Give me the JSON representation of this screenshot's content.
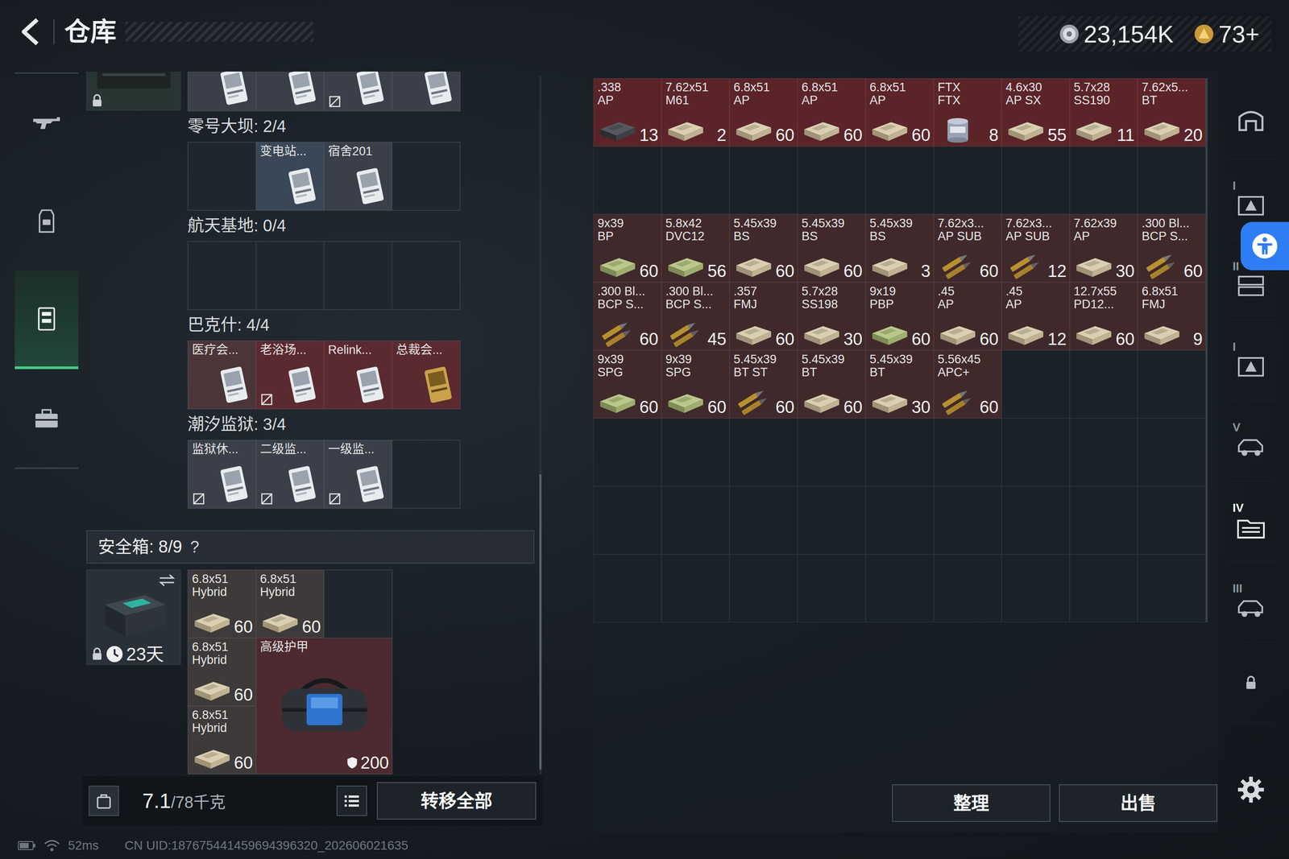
{
  "header": {
    "title": "仓库"
  },
  "currency": [
    {
      "amount": "23,154K",
      "kind": "silver"
    },
    {
      "amount": "73+",
      "kind": "gold"
    }
  ],
  "sidebar": {
    "items": [
      {
        "kind": "weapon",
        "selected": false
      },
      {
        "kind": "gear",
        "selected": false
      },
      {
        "kind": "storage",
        "selected": true
      },
      {
        "kind": "case",
        "selected": false
      }
    ]
  },
  "top_row": {
    "locked": true,
    "slots": [
      {
        "bound": false
      },
      {
        "bound": false
      },
      {
        "bound": true
      },
      {
        "bound": false
      }
    ]
  },
  "key_groups": [
    {
      "title": "零号大坝: 2/4",
      "slots": [
        null,
        {
          "label": "变电站...",
          "kind": "card",
          "color": "#3a4756",
          "bound": false
        },
        {
          "label": "宿舍201",
          "kind": "card",
          "color": "#3a3f49",
          "bound": false
        },
        null
      ]
    },
    {
      "title": "航天基地: 0/4",
      "slots": [
        null,
        null,
        null,
        null
      ]
    },
    {
      "title": "巴克什: 4/4",
      "slots": [
        {
          "label": "医疗会...",
          "kind": "card",
          "color": "#4a3539",
          "bound": false
        },
        {
          "label": "老浴场...",
          "kind": "card",
          "color": "#5a2a30",
          "bound": true
        },
        {
          "label": "Relink...",
          "kind": "card",
          "color": "#5a2a30",
          "bound": false
        },
        {
          "label": "总裁会...",
          "kind": "gold",
          "color": "#5a2a30",
          "bound": false
        }
      ]
    },
    {
      "title": "潮汐监狱: 3/4",
      "slots": [
        {
          "label": "监狱休...",
          "kind": "card",
          "color": "#3a3f49",
          "bound": true
        },
        {
          "label": "二级监...",
          "kind": "card",
          "color": "#3a3f49",
          "bound": true
        },
        {
          "label": "一级监...",
          "kind": "card",
          "color": "#3a3f49",
          "bound": true
        },
        null
      ]
    }
  ],
  "safe_box": {
    "title": "安全箱: 8/9",
    "help": "?",
    "timer": "23天",
    "locked": true,
    "slots": [
      {
        "name": "6.8x51",
        "type": "Hybrid",
        "count": "60",
        "kind": "box",
        "color": "#3e3a3a"
      },
      {
        "name": "6.8x51",
        "type": "Hybrid",
        "count": "60",
        "kind": "box",
        "color": "#3e3a3a"
      },
      null,
      {
        "name": "6.8x51",
        "type": "Hybrid",
        "count": "60",
        "kind": "box",
        "color": "#3e3a3a"
      },
      {
        "name": "高级护甲",
        "count": "200",
        "kind": "armor",
        "color": "#4c2a2f"
      },
      {
        "name": "6.8x51",
        "type": "Hybrid",
        "count": "60",
        "kind": "box",
        "color": "#3e3a3a"
      }
    ]
  },
  "load": {
    "weight": "7.1",
    "capacity": "/78千克"
  },
  "transfer_button": "转移全部",
  "stash": {
    "rows": [
      [
        {
          "name": ".338",
          "type": "AP",
          "count": "13",
          "kind": "darkbox",
          "color": "#5b2429"
        },
        {
          "name": "7.62x51",
          "type": "M61",
          "count": "2",
          "kind": "box",
          "color": "#5b2429"
        },
        {
          "name": "6.8x51",
          "type": "AP",
          "count": "60",
          "kind": "box",
          "color": "#5b2429"
        },
        {
          "name": "6.8x51",
          "type": "AP",
          "count": "60",
          "kind": "box",
          "color": "#5b2429"
        },
        {
          "name": "6.8x51",
          "type": "AP",
          "count": "60",
          "kind": "box",
          "color": "#5b2429"
        },
        {
          "name": "FTX",
          "type": "FTX",
          "count": "8",
          "kind": "can",
          "color": "#5b2429"
        },
        {
          "name": "4.6x30",
          "type": "AP SX",
          "count": "55",
          "kind": "box",
          "color": "#5b2429"
        },
        {
          "name": "5.7x28",
          "type": "SS190",
          "count": "11",
          "kind": "box",
          "color": "#5b2429"
        },
        {
          "name": "7.62x5...",
          "type": "BT",
          "count": "20",
          "kind": "box",
          "color": "#5b2429"
        }
      ],
      [],
      [
        {
          "name": "9x39",
          "type": "BP",
          "count": "60",
          "kind": "greenbox",
          "color": "#40292b"
        },
        {
          "name": "5.8x42",
          "type": "DVC12",
          "count": "56",
          "kind": "greenbox",
          "color": "#40292b"
        },
        {
          "name": "5.45x39",
          "type": "BS",
          "count": "60",
          "kind": "box",
          "color": "#40292b"
        },
        {
          "name": "5.45x39",
          "type": "BS",
          "count": "60",
          "kind": "box",
          "color": "#40292b"
        },
        {
          "name": "5.45x39",
          "type": "BS",
          "count": "3",
          "kind": "box",
          "color": "#40292b"
        },
        {
          "name": "7.62x3...",
          "type": "AP SUB",
          "count": "60",
          "kind": "bullet",
          "color": "#40292b"
        },
        {
          "name": "7.62x3...",
          "type": "AP SUB",
          "count": "12",
          "kind": "bullet",
          "color": "#40292b"
        },
        {
          "name": "7.62x39",
          "type": "AP",
          "count": "30",
          "kind": "box",
          "color": "#40292b"
        },
        {
          "name": ".300 Bl...",
          "type": "BCP S...",
          "count": "60",
          "kind": "bullet",
          "color": "#40292b"
        }
      ],
      [
        {
          "name": ".300 Bl...",
          "type": "BCP S...",
          "count": "60",
          "kind": "bullet",
          "color": "#40292b"
        },
        {
          "name": ".300 Bl...",
          "type": "BCP S...",
          "count": "45",
          "kind": "bullet",
          "color": "#40292b"
        },
        {
          "name": ".357",
          "type": "FMJ",
          "count": "60",
          "kind": "box",
          "color": "#40292b"
        },
        {
          "name": "5.7x28",
          "type": "SS198",
          "count": "30",
          "kind": "box",
          "color": "#40292b"
        },
        {
          "name": "9x19",
          "type": "PBP",
          "count": "60",
          "kind": "greenbox",
          "color": "#40292b"
        },
        {
          "name": ".45",
          "type": "AP",
          "count": "60",
          "kind": "box",
          "color": "#40292b"
        },
        {
          "name": ".45",
          "type": "AP",
          "count": "12",
          "kind": "box",
          "color": "#40292b"
        },
        {
          "name": "12.7x55",
          "type": "PD12...",
          "count": "60",
          "kind": "box",
          "color": "#40292b"
        },
        {
          "name": "6.8x51",
          "type": "FMJ",
          "count": "9",
          "kind": "box",
          "color": "#40292b"
        }
      ],
      [
        {
          "name": "9x39",
          "type": "SPG",
          "count": "60",
          "kind": "greenbox",
          "color": "#40292b"
        },
        {
          "name": "9x39",
          "type": "SPG",
          "count": "60",
          "kind": "greenbox",
          "color": "#40292b"
        },
        {
          "name": "5.45x39",
          "type": "BT ST",
          "count": "60",
          "kind": "bullet",
          "color": "#40292b"
        },
        {
          "name": "5.45x39",
          "type": "BT",
          "count": "60",
          "kind": "box",
          "color": "#40292b"
        },
        {
          "name": "5.45x39",
          "type": "BT",
          "count": "30",
          "kind": "box",
          "color": "#40292b"
        },
        {
          "name": "5.56x45",
          "type": "APC+",
          "count": "60",
          "kind": "bullet",
          "color": "#40292b"
        }
      ],
      [],
      [],
      []
    ]
  },
  "stash_tabs": [
    {
      "kind": "home",
      "selected": false
    },
    {
      "kind": "warn",
      "numeral": "I",
      "selected": false
    },
    {
      "kind": "crate",
      "numeral": "II",
      "selected": false
    },
    {
      "kind": "warn",
      "numeral": "I",
      "selected": false
    },
    {
      "kind": "car",
      "numeral": "V",
      "selected": false
    },
    {
      "kind": "folder",
      "numeral": "IV",
      "selected": true
    },
    {
      "kind": "car",
      "numeral": "III",
      "selected": false
    },
    {
      "kind": "lock",
      "selected": false
    }
  ],
  "stash_actions": [
    "整理",
    "出售"
  ],
  "status_bar": {
    "ping": "52ms",
    "uid": "CN UID:187675441459694396320_202606021635"
  }
}
